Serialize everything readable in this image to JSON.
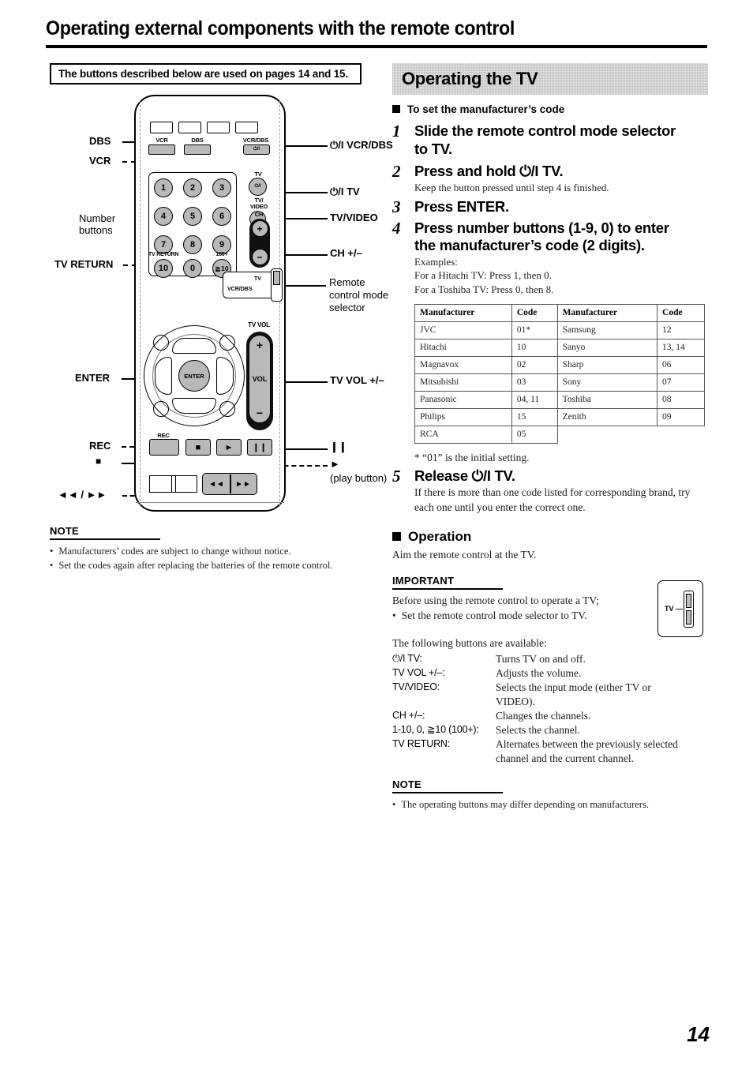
{
  "header": {
    "title": "Operating external components with the remote control"
  },
  "left": {
    "callout": "The buttons described below are used on pages 14 and 15.",
    "figure_labels": {
      "dbs": "DBS",
      "vcr": "VCR",
      "number_buttons_l1": "Number",
      "number_buttons_l2": "buttons",
      "tv_return": "TV RETURN",
      "enter": "ENTER",
      "rec": "REC",
      "stop": "■",
      "rew_ff": "◄◄ / ►►",
      "power_vcr_dbs": "⏻/I VCR/DBS",
      "power_tv": "⏻/I TV",
      "tv_video": "TV/VIDEO",
      "ch_plus_minus": "CH +/–",
      "mode_selector_l1": "Remote",
      "mode_selector_l2": "control mode",
      "mode_selector_l3": "selector",
      "tv_vol": "TV VOL +/–",
      "pause": "❙❙",
      "play": "►",
      "play_note": "(play button)"
    },
    "remote": {
      "btn_vcr": "VCR",
      "btn_dbs": "DBS",
      "btn_vcr_dbs": "VCR/DBS",
      "btn_vcr_dbs_glyph": "⏻/I",
      "btn_tv": "TV",
      "btn_tv_glyph": "⏻/I",
      "btn_tv_video_l1": "TV/",
      "btn_tv_video_l2": "VIDEO",
      "ch_label": "CH",
      "ch_plus": "+",
      "ch_minus": "−",
      "tv_vol_label": "TV VOL",
      "vol_plus": "+",
      "vol_text": "VOL",
      "vol_minus": "−",
      "enter_label": "ENTER",
      "rec_label": "REC",
      "tv_return_label": "TV RETURN",
      "hundred_plus_label": "100+",
      "mode_tv": "TV",
      "mode_vcr_dbs": "VCR/DBS",
      "numbers": [
        "1",
        "2",
        "3",
        "4",
        "5",
        "6",
        "7",
        "8",
        "9"
      ],
      "key_10": "10",
      "key_0": "0",
      "key_ge10": "≧ 10",
      "stop_glyph": "■",
      "play_glyph": "►",
      "pause_glyph": "❙❙",
      "rew_glyph": "◄◄",
      "ff_glyph": "►►"
    },
    "note": {
      "heading": "NOTE",
      "items": [
        "Manufacturers’ codes are subject to change without notice.",
        "Set the codes again after replacing the batteries of the remote control."
      ]
    }
  },
  "right": {
    "banner_title": "Operating the TV",
    "section_code_heading": "To set the manufacturer’s code",
    "steps": [
      {
        "n": "1",
        "text": "Slide the remote control mode selector to TV.",
        "sub": []
      },
      {
        "n": "2",
        "text": "Press and hold ⏻/I TV.",
        "sub": [
          "Keep the button pressed until step 4 is finished."
        ]
      },
      {
        "n": "3",
        "text": "Press ENTER.",
        "sub": []
      },
      {
        "n": "4",
        "text": "Press number buttons (1-9, 0) to enter the manufacturer’s code (2 digits).",
        "sub": [
          "Examples:",
          "For a Hitachi TV: Press 1, then 0.",
          "For a Toshiba TV: Press 0, then 8."
        ]
      }
    ],
    "table": {
      "headers": [
        "Manufacturer",
        "Code",
        "Manufacturer",
        "Code"
      ],
      "rows": [
        [
          "JVC",
          "01*",
          "Samsung",
          "12"
        ],
        [
          "Hitachi",
          "10",
          "Sanyo",
          "13, 14"
        ],
        [
          "Magnavox",
          "02",
          "Sharp",
          "06"
        ],
        [
          "Mitsubishi",
          "03",
          "Sony",
          "07"
        ],
        [
          "Panasonic",
          "04, 11",
          "Toshiba",
          "08"
        ],
        [
          "Philips",
          "15",
          "Zenith",
          "09"
        ],
        [
          "RCA",
          "05",
          "",
          ""
        ]
      ]
    },
    "table_footnote": "* “01” is the initial setting.",
    "step5": {
      "n": "5",
      "text": "Release ⏻/I TV.",
      "sub": "If there is more than one code listed for corresponding brand, try each one until you enter the correct one."
    },
    "operation_heading": "Operation",
    "operation_text": "Aim the remote control at the TV.",
    "important_heading": "IMPORTANT",
    "important_line": "Before using the remote control to operate a TV;",
    "important_bullet": "Set the remote control mode selector to TV.",
    "available_intro": "The following buttons are available:",
    "button_rows": [
      {
        "key": "⏻/I TV:",
        "value": "Turns TV on and off.",
        "cont": ""
      },
      {
        "key": "TV VOL +/–:",
        "value": "Adjusts the volume.",
        "cont": ""
      },
      {
        "key": "TV/VIDEO:",
        "value": "Selects the input mode (either TV or",
        "cont": "VIDEO)."
      },
      {
        "key": "CH +/–:",
        "value": "Changes the channels.",
        "cont": ""
      },
      {
        "key": "1-10, 0, ≧10 (100+):",
        "value": "Selects the channel.",
        "cont": ""
      },
      {
        "key": "TV RETURN:",
        "value": "Alternates between the previously selected",
        "cont": "channel and the current channel."
      }
    ],
    "tv_selector_box_label": "TV —",
    "note": {
      "heading": "NOTE",
      "items": [
        "The operating buttons may differ depending on manufacturers."
      ]
    }
  },
  "footer": {
    "page_number": "14"
  }
}
